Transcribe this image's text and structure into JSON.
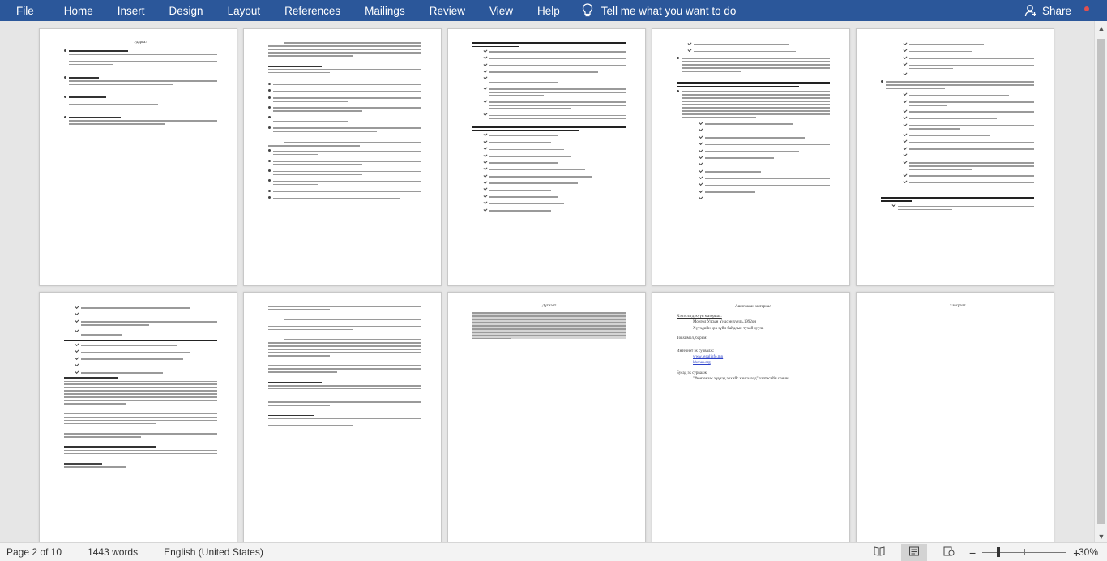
{
  "ribbon": {
    "file": "File",
    "tabs": [
      "Home",
      "Insert",
      "Design",
      "Layout",
      "References",
      "Mailings",
      "Review",
      "View",
      "Help"
    ],
    "tell_me": "Tell me what you want to do",
    "share": "Share"
  },
  "pages": {
    "p1_title": "Ударгал",
    "p8_title": "Дүгнэлт",
    "p9_title": "Ашигласан материал",
    "p9_lines": [
      "Хэрэглэгдэхүүн материал:",
      "Монгол Улсын Үндсэн хууль,1992он",
      "Хүүхдийн эрх зүйн байдлын тухай хууль",
      "Товхимол, барим:",
      "Интернэт эх сурвалж:",
      "www.legalinfo.mn",
      "khchas.org",
      "Бусад эх сурвалж:",
      "\"Фонтенээс хүүхэд эрхийг хангалаад\" хэлтэсийн сонин"
    ],
    "p10_title": "Хавсралт"
  },
  "status": {
    "page": "Page 2 of 10",
    "words": "1443 words",
    "language": "English (United States)",
    "zoom": "30%"
  },
  "colors": {
    "ribbon": "#2b579a",
    "canvas": "#e6e6e6",
    "status": "#f3f3f3"
  }
}
